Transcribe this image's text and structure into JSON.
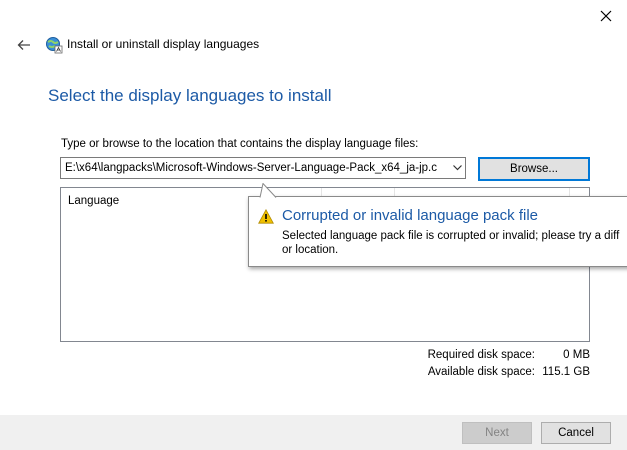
{
  "window": {
    "title": "Install or uninstall display languages",
    "icons": {
      "back": "back-arrow-icon",
      "app": "globe-language-icon",
      "close": "close-icon"
    }
  },
  "page": {
    "title": "Select the display languages to install"
  },
  "path": {
    "label": "Type or browse to the location that contains the display language files:",
    "value": "E:\\x64\\langpacks\\Microsoft-Windows-Server-Language-Pack_x64_ja-jp.c",
    "browse_label": "Browse..."
  },
  "table": {
    "columns": [
      "Language"
    ]
  },
  "tooltip": {
    "title": "Corrupted or invalid language pack file",
    "body_line1": "Selected language pack file is corrupted or invalid; please try a diff",
    "body_line2": "or location.",
    "icon": "warning-icon",
    "accent": "#1c5aa6"
  },
  "disk": {
    "required_label": "Required disk space:",
    "required_value": "0 MB",
    "available_label": "Available disk space:",
    "available_value": "115.1 GB"
  },
  "footer": {
    "next_label": "Next",
    "cancel_label": "Cancel"
  },
  "colors": {
    "title_blue": "#1c5aa6",
    "focus_border": "#0078d7",
    "warning_yellow": "#f0c000"
  }
}
